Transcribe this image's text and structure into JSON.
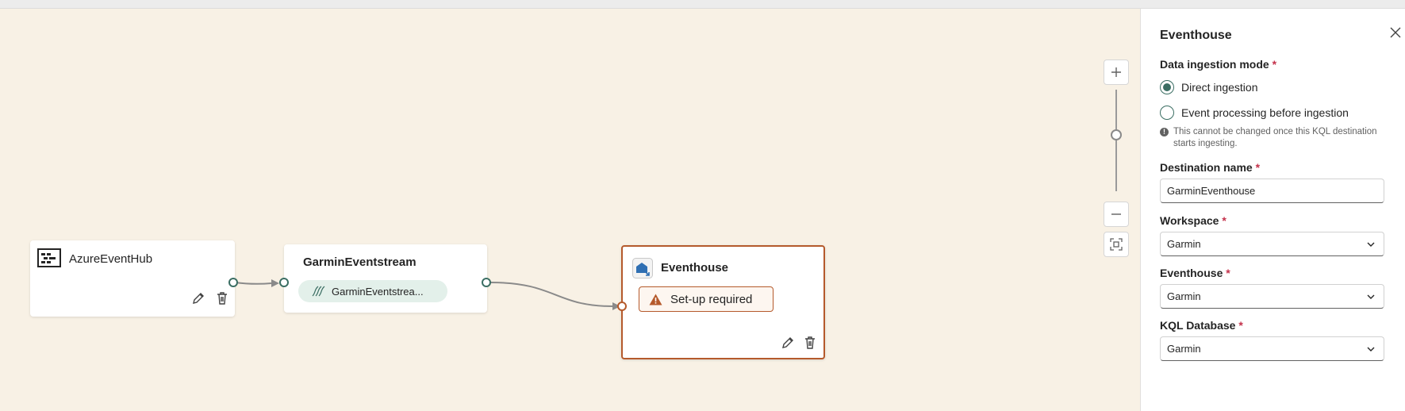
{
  "canvas": {
    "nodes": {
      "source": {
        "title": "AzureEventHub"
      },
      "stream": {
        "title": "GarminEventstream",
        "pill": "GarminEventstrea..."
      },
      "destination": {
        "title": "Eventhouse",
        "status": "Set-up required"
      }
    }
  },
  "panel": {
    "title": "Eventhouse",
    "ingestion_mode": {
      "label": "Data ingestion mode",
      "required_mark": "*",
      "options": [
        "Direct ingestion",
        "Event processing before ingestion"
      ],
      "selected": "Direct ingestion",
      "note": "This cannot be changed once this KQL destination starts ingesting."
    },
    "destination_name": {
      "label": "Destination name",
      "required_mark": "*",
      "value": "GarminEventhouse"
    },
    "workspace": {
      "label": "Workspace",
      "required_mark": "*",
      "value": "Garmin"
    },
    "eventhouse": {
      "label": "Eventhouse",
      "required_mark": "*",
      "value": "Garmin"
    },
    "kql_database": {
      "label": "KQL Database",
      "required_mark": "*",
      "value": "Garmin"
    }
  },
  "colors": {
    "canvas_bg": "#f8f1e5",
    "accent": "#3b6e63",
    "warning": "#b55a2c",
    "required": "#c4314b"
  },
  "icons": [
    "event-hub-icon",
    "edit-icon",
    "delete-icon",
    "eventstream-icon",
    "eventhouse-icon",
    "warning-icon",
    "zoom-in-icon",
    "zoom-out-icon",
    "fit-view-icon",
    "close-icon",
    "info-icon",
    "chevron-down-icon"
  ]
}
